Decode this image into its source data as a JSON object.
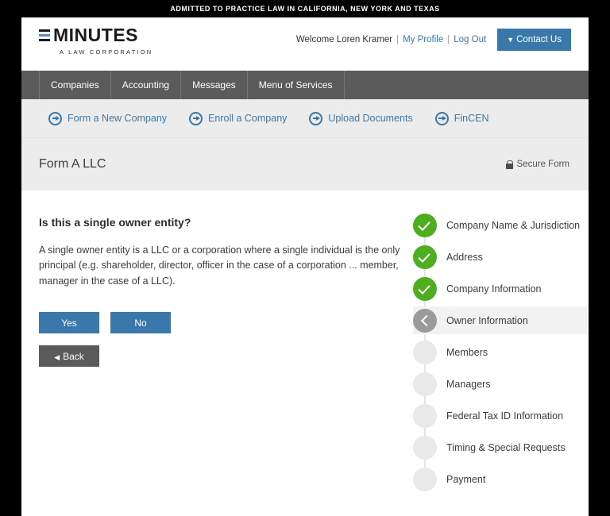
{
  "top_banner": {
    "text": "ADMITTED TO PRACTICE LAW IN CALIFORNIA, NEW YORK AND TEXAS"
  },
  "brand": {
    "name": "MINUTES",
    "tagline": "A LAW CORPORATION",
    "logo_icon": "eminutes-e-logo",
    "accent_color": "#5b8fc4"
  },
  "user_bar": {
    "welcome": "Welcome Loren Kramer",
    "separator": "|",
    "my_profile": "My Profile",
    "log_out": "Log Out",
    "contact_label": "Contact Us",
    "contact_caret": "▼"
  },
  "main_nav": {
    "items": [
      {
        "label": "Companies"
      },
      {
        "label": "Accounting"
      },
      {
        "label": "Messages"
      },
      {
        "label": "Menu of Services"
      }
    ]
  },
  "sub_nav": {
    "items": [
      {
        "label": "Form a New Company",
        "icon": "circle-arrow-right-icon"
      },
      {
        "label": "Enroll a Company",
        "icon": "circle-arrow-right-icon"
      },
      {
        "label": "Upload Documents",
        "icon": "circle-arrow-right-icon"
      },
      {
        "label": "FinCEN",
        "icon": "circle-arrow-right-icon"
      }
    ]
  },
  "title_band": {
    "title": "Form A LLC",
    "secure_label": "Secure Form",
    "secure_icon": "lock-icon"
  },
  "form": {
    "question": "Is this a single owner entity?",
    "help_text": "A single owner entity is a LLC or a corporation where a single individual is the only principal (e.g. shareholder, director, officer in the case of a corporation ... member, manager in the case of a LLC).",
    "yes_label": "Yes",
    "no_label": "No",
    "back_label": "Back",
    "back_caret": "◀"
  },
  "steps": {
    "items": [
      {
        "label": "Company Name & Jurisdiction",
        "state": "done"
      },
      {
        "label": "Address",
        "state": "done"
      },
      {
        "label": "Company Information",
        "state": "done"
      },
      {
        "label": "Owner Information",
        "state": "active"
      },
      {
        "label": "Members",
        "state": "pending"
      },
      {
        "label": "Managers",
        "state": "pending"
      },
      {
        "label": "Federal Tax ID Information",
        "state": "pending"
      },
      {
        "label": "Timing & Special Requests",
        "state": "pending"
      },
      {
        "label": "Payment",
        "state": "pending"
      }
    ]
  },
  "colors": {
    "primary_blue": "#3a78ab",
    "nav_gray": "#5b5b5b",
    "done_green": "#4fae1f",
    "active_gray": "#9b9b9b",
    "band_gray": "#ececec"
  }
}
